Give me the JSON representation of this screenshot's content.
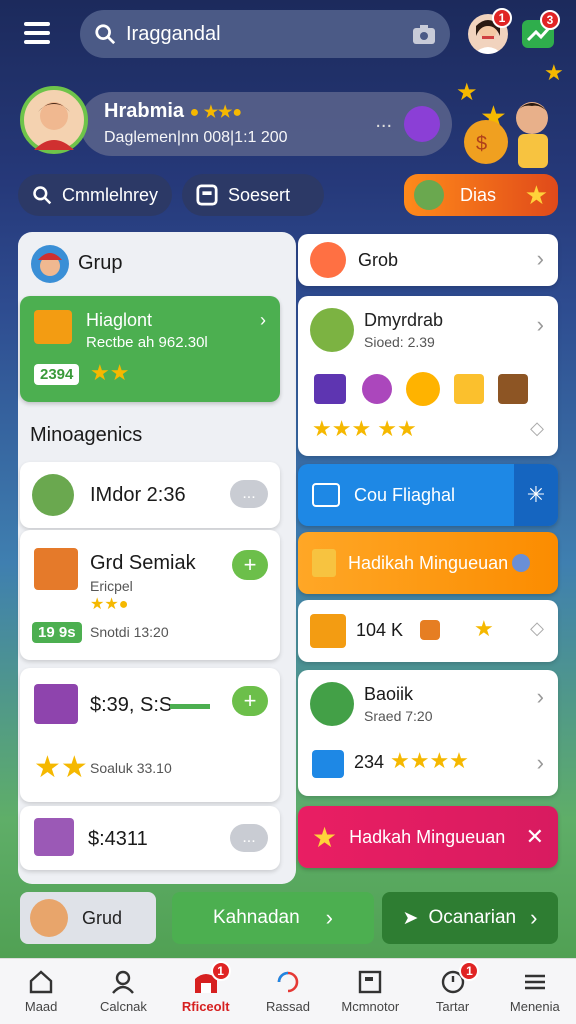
{
  "header": {
    "search_value": "Iraggandal",
    "notif_badge_1": "1",
    "notif_badge_2": "3"
  },
  "profile": {
    "name": "Hrabmia",
    "subtitle": "Daglemen|nn 008|1:1 200",
    "more": "..."
  },
  "quick_actions": {
    "community": "Cmmlelnrey",
    "search": "Soesert",
    "promo": "Dias"
  },
  "left_panel": {
    "header_title": "Grup",
    "highlight_title": "Hiaglont",
    "highlight_sub": "Rectbe ah 962.30l",
    "highlight_badge": "2394",
    "section_title": "Minoagenics",
    "rows": [
      {
        "title": "IMdor 2:36",
        "action": "..."
      },
      {
        "title": "Grd Semiak",
        "sub": "Ericpel",
        "badge": "19 9s",
        "meta": "Snotdi 13:20",
        "action": "+"
      },
      {
        "title": "$:39, S:S",
        "meta": "Soaluk 33.10",
        "action": "+"
      },
      {
        "title": "$:4311",
        "action": "..."
      }
    ]
  },
  "right_panel": {
    "header_title": "Grob",
    "gift_title": "Dmyrdrab",
    "gift_sub": "Sioed: 2.39",
    "blue_card": "Cou Fliaghal",
    "orange_card": "Hadikah Mingueuan",
    "value_row": "104 K",
    "person_title": "Baoiik",
    "person_sub": "Sraed 7:20",
    "person_value": "234",
    "pink_card": "Hadkah Mingueuan"
  },
  "bottom_row": {
    "grud": "Grud",
    "green_btn": "Kahnadan",
    "dark_btn": "Ocanarian"
  },
  "nav": [
    {
      "label": "Maad",
      "icon": "home-icon"
    },
    {
      "label": "Calcnak",
      "icon": "profile-icon"
    },
    {
      "label": "Rficeolt",
      "icon": "store-icon",
      "badge": "1"
    },
    {
      "label": "Rassad",
      "icon": "refresh-icon"
    },
    {
      "label": "Mcmnotor",
      "icon": "monitor-icon"
    },
    {
      "label": "Tartar",
      "icon": "timer-icon",
      "badge": "1"
    },
    {
      "label": "Menenia",
      "icon": "menu-icon"
    }
  ],
  "colors": {
    "green": "#4caf50",
    "blue": "#1e88e5",
    "orange": "#ff9800",
    "pink": "#e91e63",
    "red": "#d62020"
  }
}
